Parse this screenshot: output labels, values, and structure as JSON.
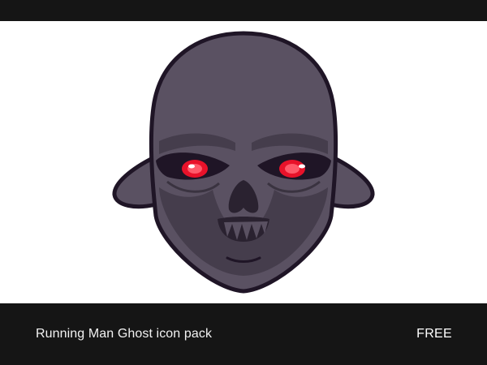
{
  "colors": {
    "top_bar": "#151515",
    "bottom_bar": "#151515",
    "canvas_background": "#ffffff",
    "skin": "#5a5162",
    "skin_shadow": "#453d4c",
    "outline": "#1f1526",
    "eye_glow": "#e8122a"
  },
  "icon": {
    "name": "ghost-face-icon"
  },
  "footer": {
    "title": "Running Man Ghost icon pack",
    "price": "FREE"
  }
}
